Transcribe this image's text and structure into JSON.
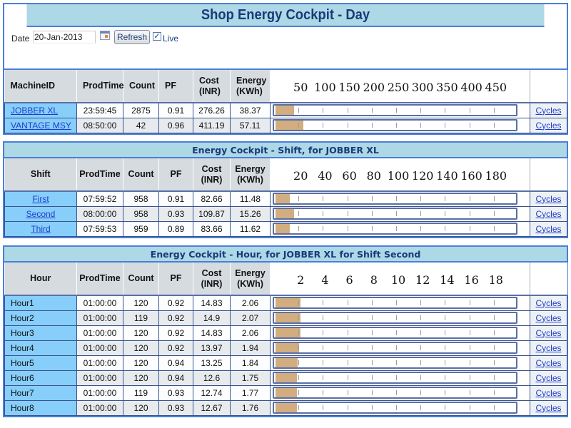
{
  "day": {
    "title": "Shop Energy Cockpit - Day",
    "controls": {
      "date_label": "Date",
      "date_value": "20-Jan-2013",
      "calendar_icon": "calendar-icon",
      "refresh_label": "Refresh",
      "live_checked": true,
      "live_check_glyph": "✓",
      "live_label": "Live"
    },
    "columns": [
      "MachineID",
      "ProdTime",
      "Count",
      "PF",
      "Cost (INR)",
      "Energy (KWh)"
    ],
    "col_labels": {
      "c1": "MachineID",
      "c2": "ProdTime",
      "c3": "Count",
      "c4": "PF",
      "c5a": "Cost",
      "c5b": "(INR)",
      "c6a": "Energy",
      "c6b": "(KWh)"
    },
    "scale": {
      "max": 500,
      "labels": [
        "50",
        "100",
        "150",
        "200",
        "250",
        "300",
        "350",
        "400",
        "450"
      ]
    },
    "rows": [
      {
        "name": "JOBBER XL",
        "prodtime": "23:59:45",
        "count": "2875",
        "pf": "0.91",
        "cost": "276.26",
        "energy": "38.37",
        "energy_value": 38.37,
        "link": "Cycles"
      },
      {
        "name": "VANTAGE MSY",
        "prodtime": "08:50:00",
        "count": "42",
        "pf": "0.96",
        "cost": "411.19",
        "energy": "57.11",
        "energy_value": 57.11,
        "link": "Cycles"
      }
    ]
  },
  "shift": {
    "title": "Energy Cockpit - Shift, for JOBBER XL",
    "col_labels": {
      "c1": "Shift",
      "c2": "ProdTime",
      "c3": "Count",
      "c4": "PF",
      "c5a": "Cost",
      "c5b": "(INR)",
      "c6a": "Energy",
      "c6b": "(KWh)"
    },
    "scale": {
      "max": 200,
      "labels": [
        "20",
        "40",
        "60",
        "80",
        "100",
        "120",
        "140",
        "160",
        "180"
      ]
    },
    "rows": [
      {
        "name": "First",
        "prodtime": "07:59:52",
        "count": "958",
        "pf": "0.91",
        "cost": "82.66",
        "energy": "11.48",
        "energy_value": 11.48,
        "link": "Cycles"
      },
      {
        "name": "Second",
        "prodtime": "08:00:00",
        "count": "958",
        "pf": "0.93",
        "cost": "109.87",
        "energy": "15.26",
        "energy_value": 15.26,
        "link": "Cycles"
      },
      {
        "name": "Third",
        "prodtime": "07:59:53",
        "count": "959",
        "pf": "0.89",
        "cost": "83.66",
        "energy": "11.62",
        "energy_value": 11.62,
        "link": "Cycles"
      }
    ]
  },
  "hour": {
    "title": "Energy Cockpit - Hour, for JOBBER XL for Shift Second",
    "col_labels": {
      "c1": "Hour",
      "c2": "ProdTime",
      "c3": "Count",
      "c4": "PF",
      "c5a": "Cost",
      "c5b": "(INR)",
      "c6a": "Energy",
      "c6b": "(KWh)"
    },
    "scale": {
      "max": 20,
      "labels": [
        "2",
        "4",
        "6",
        "8",
        "10",
        "12",
        "14",
        "16",
        "18"
      ]
    },
    "rows": [
      {
        "name": "Hour1",
        "prodtime": "01:00:00",
        "count": "120",
        "pf": "0.92",
        "cost": "14.83",
        "energy": "2.06",
        "energy_value": 2.06,
        "link": "Cycles"
      },
      {
        "name": "Hour2",
        "prodtime": "01:00:00",
        "count": "119",
        "pf": "0.92",
        "cost": "14.9",
        "energy": "2.07",
        "energy_value": 2.07,
        "link": "Cycles"
      },
      {
        "name": "Hour3",
        "prodtime": "01:00:00",
        "count": "120",
        "pf": "0.92",
        "cost": "14.83",
        "energy": "2.06",
        "energy_value": 2.06,
        "link": "Cycles"
      },
      {
        "name": "Hour4",
        "prodtime": "01:00:00",
        "count": "120",
        "pf": "0.92",
        "cost": "13.97",
        "energy": "1.94",
        "energy_value": 1.94,
        "link": "Cycles"
      },
      {
        "name": "Hour5",
        "prodtime": "01:00:00",
        "count": "120",
        "pf": "0.94",
        "cost": "13.25",
        "energy": "1.84",
        "energy_value": 1.84,
        "link": "Cycles"
      },
      {
        "name": "Hour6",
        "prodtime": "01:00:00",
        "count": "120",
        "pf": "0.94",
        "cost": "12.6",
        "energy": "1.75",
        "energy_value": 1.75,
        "link": "Cycles"
      },
      {
        "name": "Hour7",
        "prodtime": "01:00:00",
        "count": "119",
        "pf": "0.93",
        "cost": "12.74",
        "energy": "1.77",
        "energy_value": 1.77,
        "link": "Cycles"
      },
      {
        "name": "Hour8",
        "prodtime": "01:00:00",
        "count": "120",
        "pf": "0.93",
        "cost": "12.67",
        "energy": "1.76",
        "energy_value": 1.76,
        "link": "Cycles"
      }
    ]
  },
  "colors": {
    "header_bg": "#add8e6",
    "title_text": "#1a3a7a",
    "first_col_bg": "#87cefa",
    "bar_fill": "#d2ad7f",
    "link": "#1d3dcc",
    "border": "#3b5390"
  }
}
